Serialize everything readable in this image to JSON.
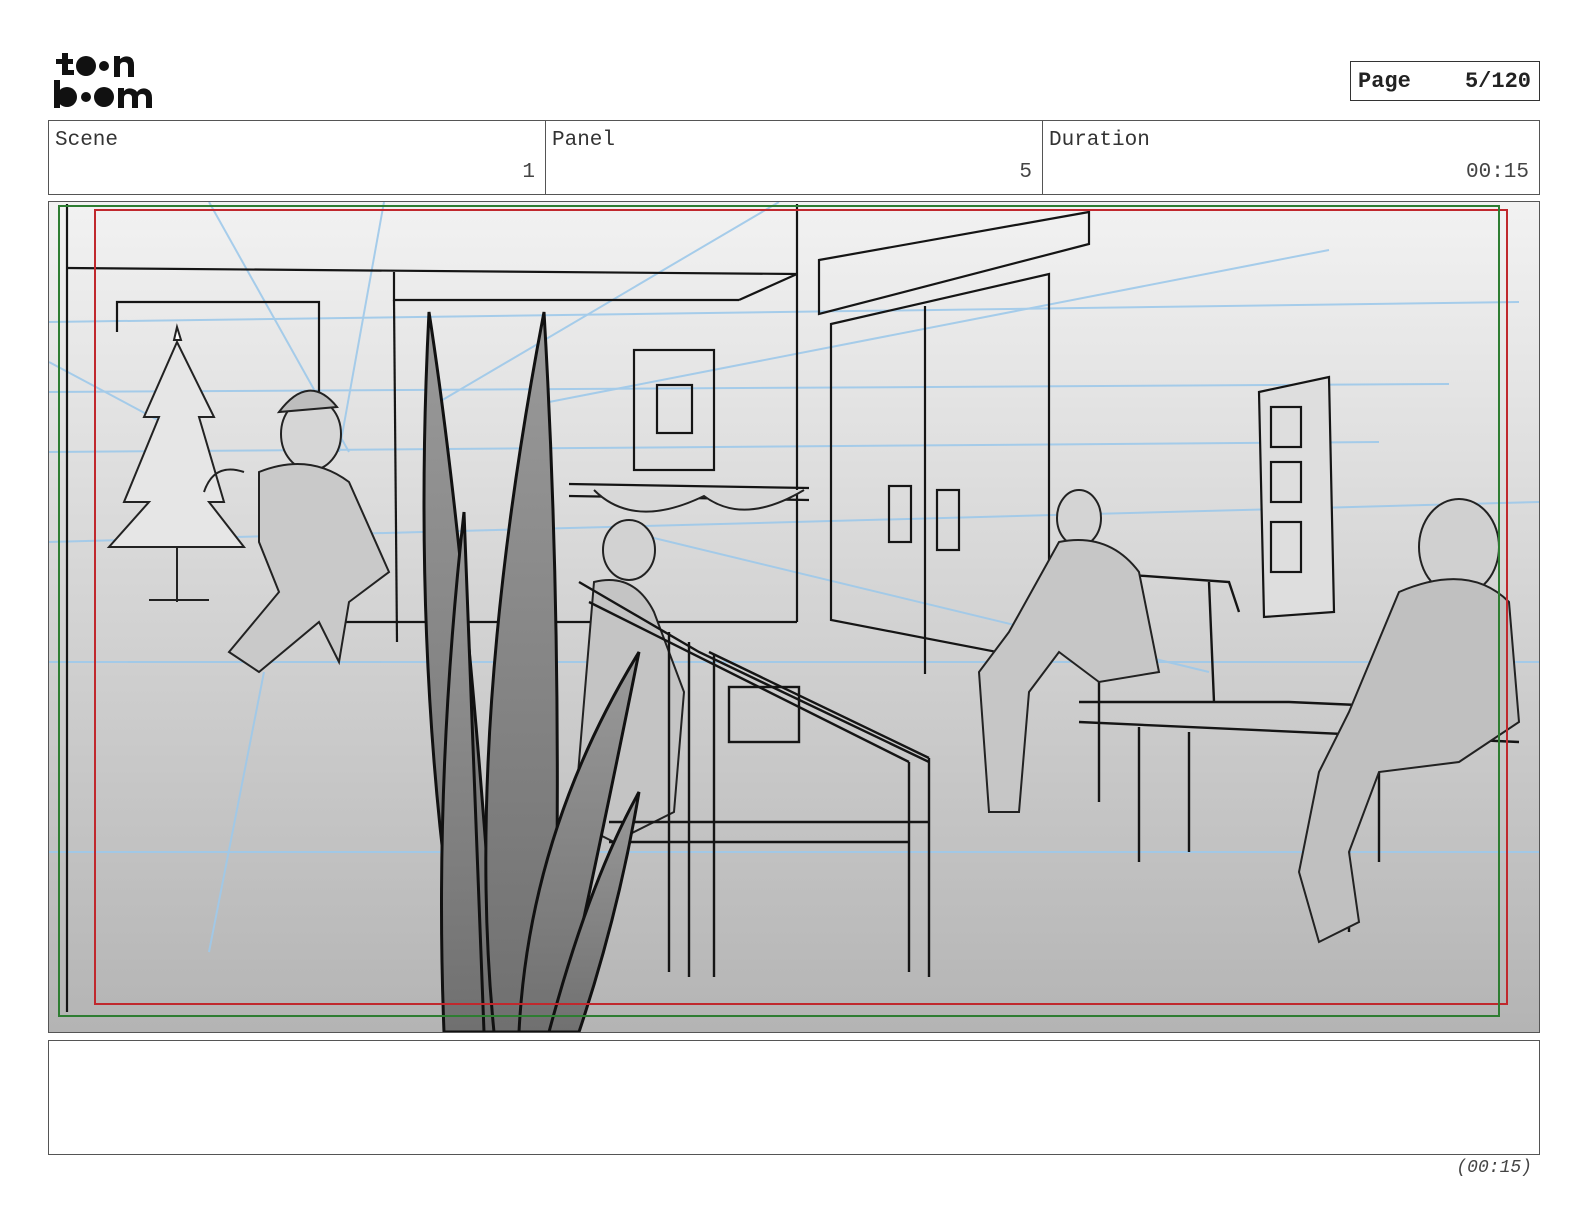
{
  "header": {
    "page_label": "Page",
    "page_value": "5/120"
  },
  "info": {
    "scene_label": "Scene",
    "scene_value": "1",
    "panel_label": "Panel",
    "panel_value": "5",
    "duration_label": "Duration",
    "duration_value": "00:15"
  },
  "notes": {
    "text": ""
  },
  "footer": {
    "duration": "(00:15)"
  },
  "colors": {
    "safe_frame_red": "#c0282d",
    "camera_frame_green": "#2e7d32",
    "guide_lines_blue": "#9ec9ea"
  }
}
